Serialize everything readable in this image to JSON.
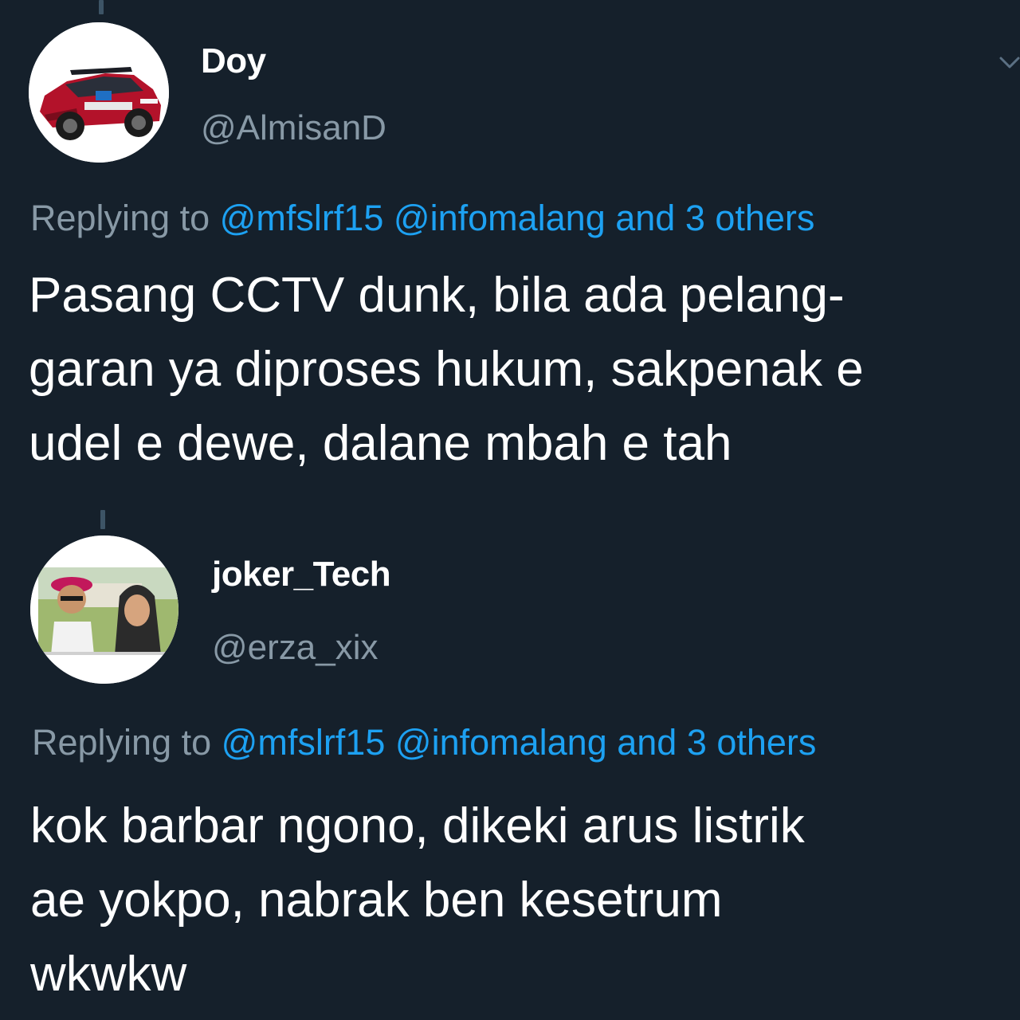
{
  "tweets": [
    {
      "name": "Doy",
      "handle": "@AlmisanD",
      "replying": {
        "prefix": "Replying to",
        "mention1": "@mfslrf15",
        "mention2": "@infomalang",
        "others": "and 3 others"
      },
      "lines": [
        "Pasang CCTV dunk, bila ada pelang-",
        "garan ya diproses hukum, sakpenak e",
        "udel e dewe, dalane mbah e tah"
      ],
      "avatar_icon": "rally-car-avatar-icon"
    },
    {
      "name": "joker_Tech",
      "handle": "@erza_xix",
      "replying": {
        "prefix": "Replying to",
        "mention1": "@mfslrf15",
        "mention2": "@infomalang",
        "others": "and 3 others"
      },
      "lines": [
        "kok barbar ngono, dikeki arus listrik",
        "ae yokpo, nabrak ben kesetrum",
        "wkwkw"
      ],
      "avatar_icon": "couple-photo-avatar-icon"
    }
  ],
  "colors": {
    "background": "#15202b",
    "text": "#ffffff",
    "secondary": "#8899a6",
    "link": "#1da1f2"
  }
}
